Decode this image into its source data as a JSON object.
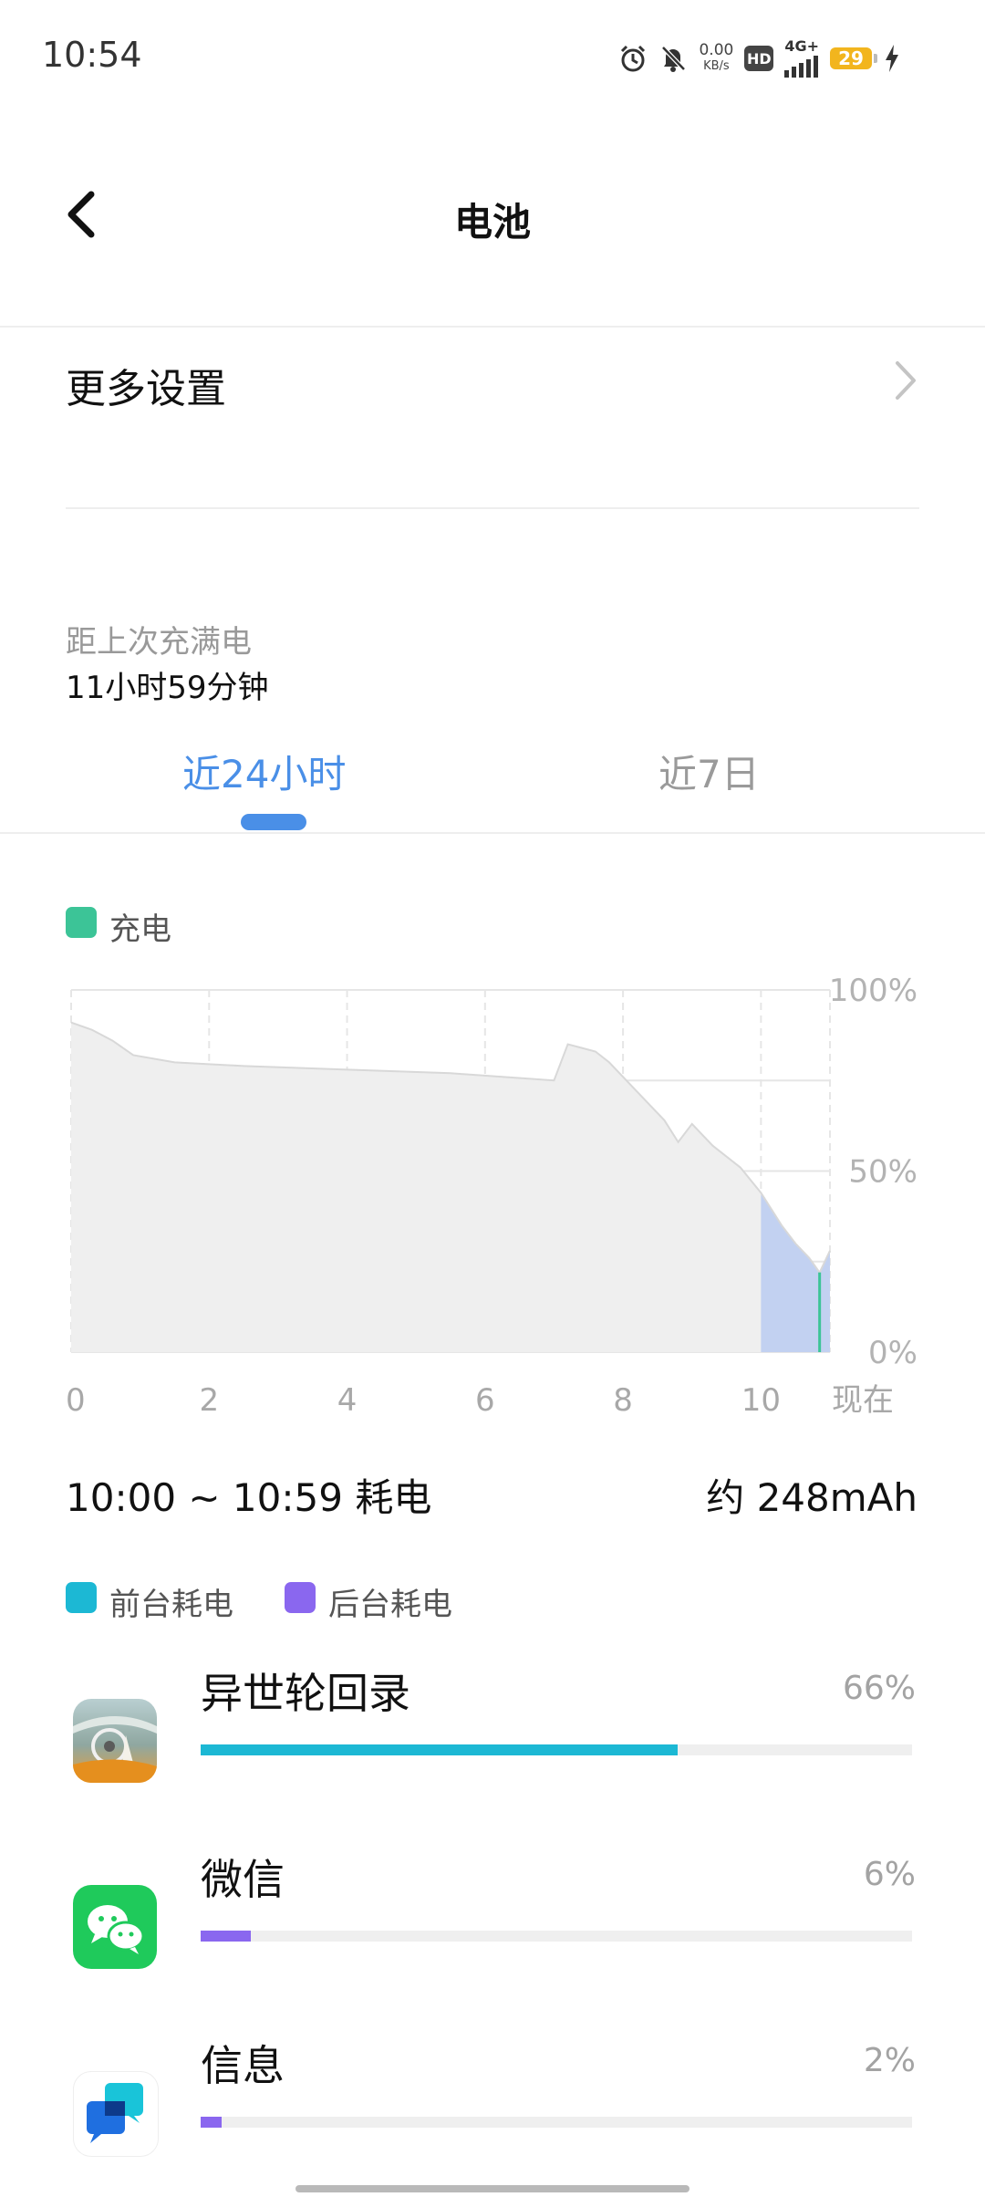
{
  "status_bar": {
    "time": "10:54",
    "net_speed_value": "0.00",
    "net_speed_unit": "KB/s",
    "hd": "HD",
    "network": "4G+",
    "battery": "29",
    "icons": [
      "alarm-icon",
      "bell-muted-icon",
      "signal-icon",
      "battery-icon",
      "charging-bolt-icon"
    ]
  },
  "header": {
    "title": "电池",
    "back_icon": "chevron-left-icon"
  },
  "more_settings": {
    "label": "更多设置",
    "icon": "chevron-right-icon"
  },
  "since_full_charge": {
    "label": "距上次充满电",
    "value": "11小时59分钟"
  },
  "tabs": [
    {
      "label": "近24小时",
      "selected": true
    },
    {
      "label": "近7日",
      "selected": false
    }
  ],
  "chart_legend": {
    "label": "充电",
    "color": "#3cc497"
  },
  "chart_data": {
    "type": "area",
    "title": "",
    "xlabel": "",
    "ylabel": "",
    "x_ticks": [
      "0",
      "2",
      "4",
      "6",
      "8",
      "10",
      "现在"
    ],
    "y_ticks": [
      "100%",
      "50%",
      "0%"
    ],
    "xlim": [
      0,
      11
    ],
    "ylim": [
      0,
      100
    ],
    "grid": true,
    "series": [
      {
        "x": [
          0,
          0.3,
          0.6,
          0.9,
          1.5,
          2.5,
          4.0,
          5.5,
          7.0,
          7.2,
          7.6,
          7.8,
          8.2,
          8.6,
          8.8,
          9.0,
          9.3,
          9.7,
          10.0,
          10.3,
          10.5,
          10.7,
          10.85,
          11.0
        ],
        "y": [
          91,
          89,
          86,
          82,
          80,
          79,
          78,
          77,
          75,
          85,
          83,
          80,
          72,
          64,
          58,
          63,
          57,
          51,
          44,
          35,
          30,
          26,
          22,
          28
        ]
      }
    ],
    "highlight_range": {
      "x_start": 10,
      "x_end": 11,
      "color": "#4f86f7"
    },
    "charging_color": "#3cc497"
  },
  "usage_summary": {
    "range": "10:00 ~ 10:59 耗电",
    "total": "约 248mAh"
  },
  "usage_legend": [
    {
      "label": "前台耗电",
      "color": "#1cb8d4"
    },
    {
      "label": "后台耗电",
      "color": "#8a67ef"
    }
  ],
  "apps": [
    {
      "name": "异世轮回录",
      "percent_label": "66%",
      "share": 0.67,
      "bar_color": "#1cb8d4",
      "icon": "game-app-icon"
    },
    {
      "name": "微信",
      "percent_label": "6%",
      "share": 0.07,
      "bar_color": "#8a67ef",
      "icon": "wechat-icon"
    },
    {
      "name": "信息",
      "percent_label": "2%",
      "share": 0.03,
      "bar_color": "#8a67ef",
      "icon": "messages-icon"
    }
  ]
}
